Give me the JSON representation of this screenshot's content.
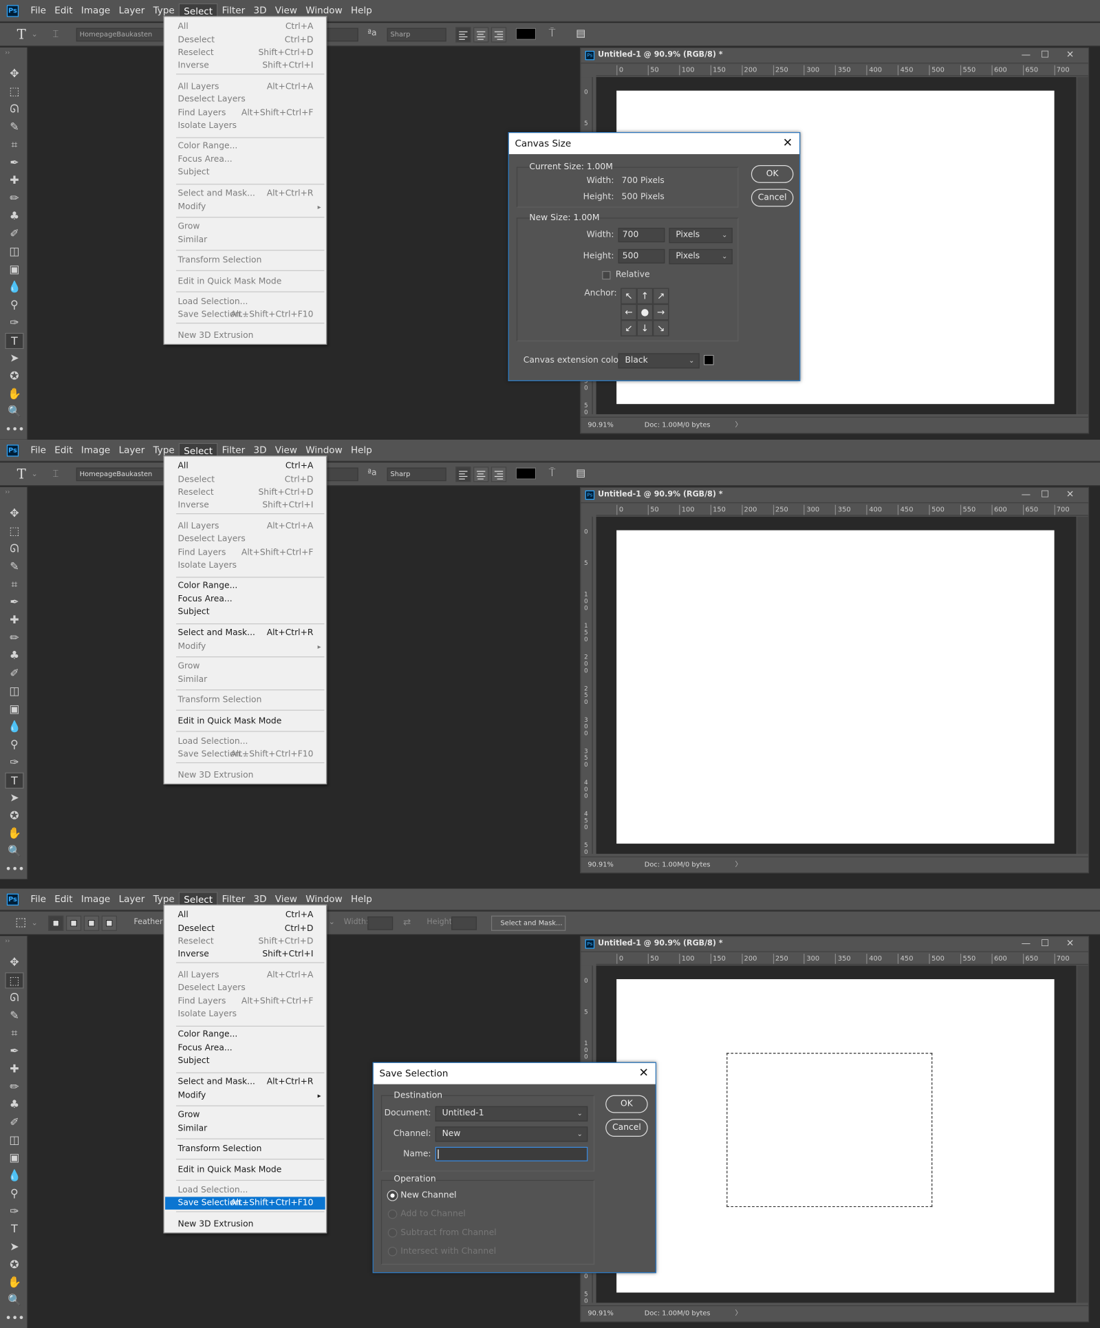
{
  "app_menu": [
    "File",
    "Edit",
    "Image",
    "Layer",
    "Type",
    "Select",
    "Filter",
    "3D",
    "View",
    "Window",
    "Help"
  ],
  "app_logo": "Ps",
  "open_menu": "Select",
  "document": {
    "title": "Untitled-1 @ 90.9% (RGB/8) *",
    "ruler_h": [
      "0",
      "50",
      "100",
      "150",
      "200",
      "250",
      "300",
      "350",
      "400",
      "450",
      "500",
      "550",
      "600",
      "650",
      "700"
    ],
    "ruler_v": [
      "0",
      "5",
      "1 0 0",
      "1 5 0",
      "2 0 0",
      "2 5 0",
      "3 0 0",
      "3 5 0",
      "4 0 0",
      "4 5 0",
      "5 0"
    ],
    "zoom": "90.91%",
    "doc_info": "Doc: 1.00M/0 bytes",
    "status_arrow": "〉"
  },
  "type_options": {
    "font": "HomepageBaukasten",
    "aa": "Sharp",
    "aa_icon": "ªa"
  },
  "marquee_options": {
    "feather": "Feather:",
    "width": "Width:",
    "height": "Height:",
    "select_mask": "Select and Mask..."
  },
  "select_menu": [
    {
      "label": "All",
      "shortcut": "Ctrl+A"
    },
    {
      "label": "Deselect",
      "shortcut": "Ctrl+D"
    },
    {
      "label": "Reselect",
      "shortcut": "Shift+Ctrl+D"
    },
    {
      "label": "Inverse",
      "shortcut": "Shift+Ctrl+I"
    },
    {
      "label": "All Layers",
      "shortcut": "Alt+Ctrl+A"
    },
    {
      "label": "Deselect Layers",
      "shortcut": ""
    },
    {
      "label": "Find Layers",
      "shortcut": "Alt+Shift+Ctrl+F"
    },
    {
      "label": "Isolate Layers",
      "shortcut": ""
    },
    {
      "label": "Color Range...",
      "shortcut": ""
    },
    {
      "label": "Focus Area...",
      "shortcut": ""
    },
    {
      "label": "Subject",
      "shortcut": ""
    },
    {
      "label": "Select and Mask...",
      "shortcut": "Alt+Ctrl+R"
    },
    {
      "label": "Modify",
      "shortcut": ""
    },
    {
      "label": "Grow",
      "shortcut": ""
    },
    {
      "label": "Similar",
      "shortcut": ""
    },
    {
      "label": "Transform Selection",
      "shortcut": ""
    },
    {
      "label": "Edit in Quick Mask Mode",
      "shortcut": ""
    },
    {
      "label": "Load Selection...",
      "shortcut": ""
    },
    {
      "label": "Save Selection...",
      "shortcut": "Alt+Shift+Ctrl+F10"
    },
    {
      "label": "New 3D Extrusion",
      "shortcut": ""
    }
  ],
  "menu_states": {
    "panel1": {
      "enabled": [],
      "highlight": -1
    },
    "panel2": {
      "enabled": [
        0,
        8,
        9,
        10,
        11,
        16
      ],
      "highlight": -1
    },
    "panel3": {
      "enabled": [
        0,
        1,
        3,
        8,
        9,
        10,
        11,
        12,
        13,
        14,
        15,
        16,
        18,
        19
      ],
      "highlight": 18
    }
  },
  "canvas_size_dialog": {
    "title": "Canvas Size",
    "current_label": "Current Size: 1.00M",
    "width_label": "Width:",
    "height_label": "Height:",
    "current_width": "700 Pixels",
    "current_height": "500 Pixels",
    "new_label": "New Size: 1.00M",
    "new_width": "700",
    "new_height": "500",
    "unit": "Pixels",
    "relative": "Relative",
    "anchor": "Anchor:",
    "ext_label": "Canvas extension color:",
    "ext_value": "Black",
    "ok": "OK",
    "cancel": "Cancel",
    "anchor_glyphs": [
      "↖",
      "↑",
      "↗",
      "←",
      "●",
      "→",
      "↙",
      "↓",
      "↘"
    ]
  },
  "save_selection_dialog": {
    "title": "Save Selection",
    "destination": "Destination",
    "document_label": "Document:",
    "document_value": "Untitled-1",
    "channel_label": "Channel:",
    "channel_value": "New",
    "name_label": "Name:",
    "name_value": "",
    "operation": "Operation",
    "ops": [
      "New Channel",
      "Add to Channel",
      "Subtract from Channel",
      "Intersect with Channel"
    ],
    "ok": "OK",
    "cancel": "Cancel"
  },
  "tools": [
    "move-icon",
    "marquee-icon",
    "lasso-icon",
    "quick-select-icon",
    "crop-icon",
    "eyedropper-icon",
    "healing-icon",
    "brush-icon",
    "stamp-icon",
    "history-brush-icon",
    "eraser-icon",
    "gradient-icon",
    "blur-icon",
    "dodge-icon",
    "pen-icon",
    "type-icon",
    "path-select-icon",
    "shape-icon",
    "hand-icon",
    "zoom-icon",
    "more-icon"
  ],
  "tool_glyphs": [
    "✥",
    "⬚",
    "ᘏ",
    "✎",
    "⌗",
    "✒",
    "✚",
    "✏",
    "♣",
    "✐",
    "◫",
    "▣",
    "💧",
    "⚲",
    "✑",
    "T",
    "➤",
    "✪",
    "✋",
    "🔍",
    "•••"
  ],
  "colors": {
    "accent": "#0b75d1",
    "dialog_border": "#2a7ac6",
    "ui": "#535353",
    "canvas": "#ffffff"
  }
}
